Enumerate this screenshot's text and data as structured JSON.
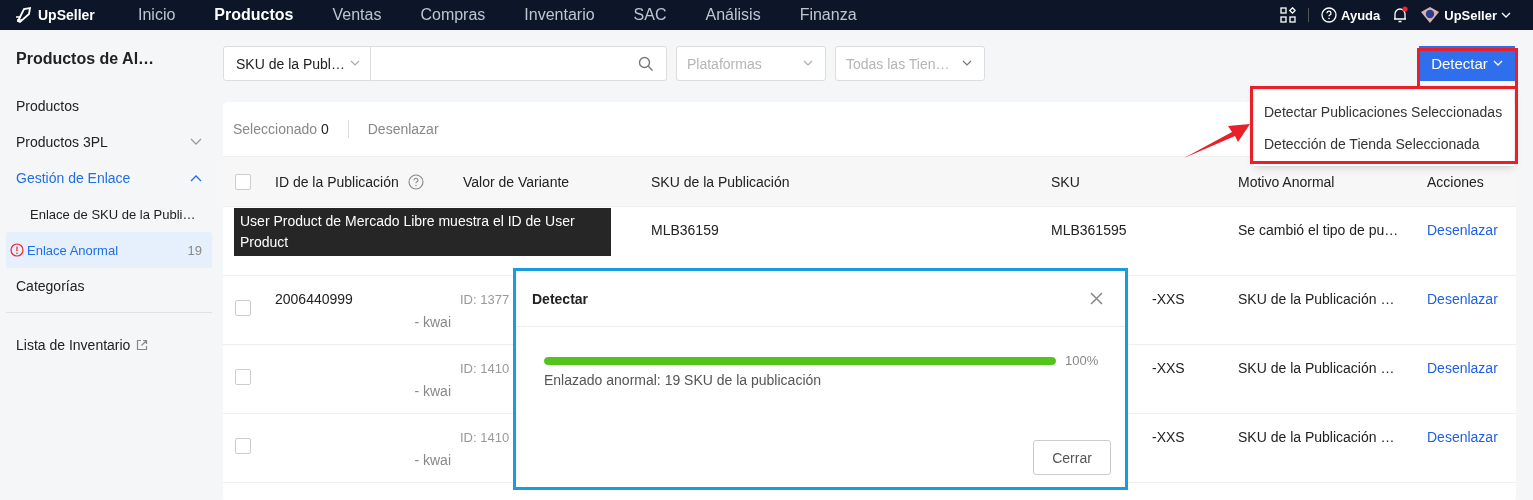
{
  "nav": {
    "brand": "UpSeller",
    "items": [
      {
        "label": "Inicio",
        "selected": false
      },
      {
        "label": "Productos",
        "selected": true
      },
      {
        "label": "Ventas",
        "selected": false
      },
      {
        "label": "Compras",
        "selected": false
      },
      {
        "label": "Inventario",
        "selected": false
      },
      {
        "label": "SAC",
        "selected": false
      },
      {
        "label": "Análisis",
        "selected": false
      },
      {
        "label": "Finanza",
        "selected": false
      }
    ],
    "help": "Ayuda",
    "notification": true,
    "account": "UpSeller"
  },
  "sidebar": {
    "title": "Productos de Al…",
    "items": [
      {
        "label": "Productos",
        "kind": "item"
      },
      {
        "label": "Productos 3PL",
        "kind": "group",
        "expanded": false
      },
      {
        "label": "Gestión de Enlace",
        "kind": "group",
        "expanded": true,
        "children": [
          {
            "label": "Enlace de SKU de la Publi…",
            "selected": false
          },
          {
            "label": "Enlace Anormal",
            "selected": true,
            "warning": true,
            "count": "19"
          }
        ]
      },
      {
        "label": "Categorías",
        "kind": "item"
      },
      {
        "label": "Lista de Inventario",
        "kind": "external"
      }
    ]
  },
  "filters": {
    "field": "SKU de la Publ…",
    "platforms": "Plataformas",
    "stores": "Todas las Tien…"
  },
  "detect_button": {
    "label": "Detectar",
    "expanded": true
  },
  "detect_menu": [
    "Detectar Publicaciones Seleccionadas",
    "Detección de Tienda Seleccionada"
  ],
  "toolbar": {
    "selected_label": "Seleccionado",
    "selected_count": "0",
    "unlink": "Desenlazar"
  },
  "table": {
    "header_checked": false,
    "columns": [
      "ID de la Publicación",
      "Valor de Variante",
      "SKU de la Publicación",
      "SKU",
      "Motivo Anormal",
      "Acciones"
    ],
    "rows": [
      {
        "listing_sku": "MLB36159",
        "sku": "MLB361595",
        "reason": "Se cambió el tipo de pu…",
        "action": "Desenlazar"
      },
      {
        "checked": false,
        "listing_id": "2006440999",
        "variant_name": "- kwai",
        "variant_id": "ID: 1377",
        "sku": "-XXS",
        "reason": "SKU de la Publicación …",
        "action": "Desenlazar"
      },
      {
        "checked": false,
        "variant_name": "- kwai",
        "variant_id": "ID: 1410",
        "sku": "-XXS",
        "reason": "SKU de la Publicación …",
        "action": "Desenlazar"
      },
      {
        "checked": false,
        "variant_name": "- kwai",
        "variant_id": "ID: 1410",
        "sku": "-XXS",
        "reason": "SKU de la Publicación …",
        "action": "Desenlazar"
      }
    ]
  },
  "tooltip": "User Product de Mercado Libre muestra el ID de User Product",
  "modal": {
    "title": "Detectar",
    "level": 1,
    "percent": "100%",
    "message": "Enlazado anormal: 19 SKU de la publicación",
    "close_button": "Cerrar"
  }
}
